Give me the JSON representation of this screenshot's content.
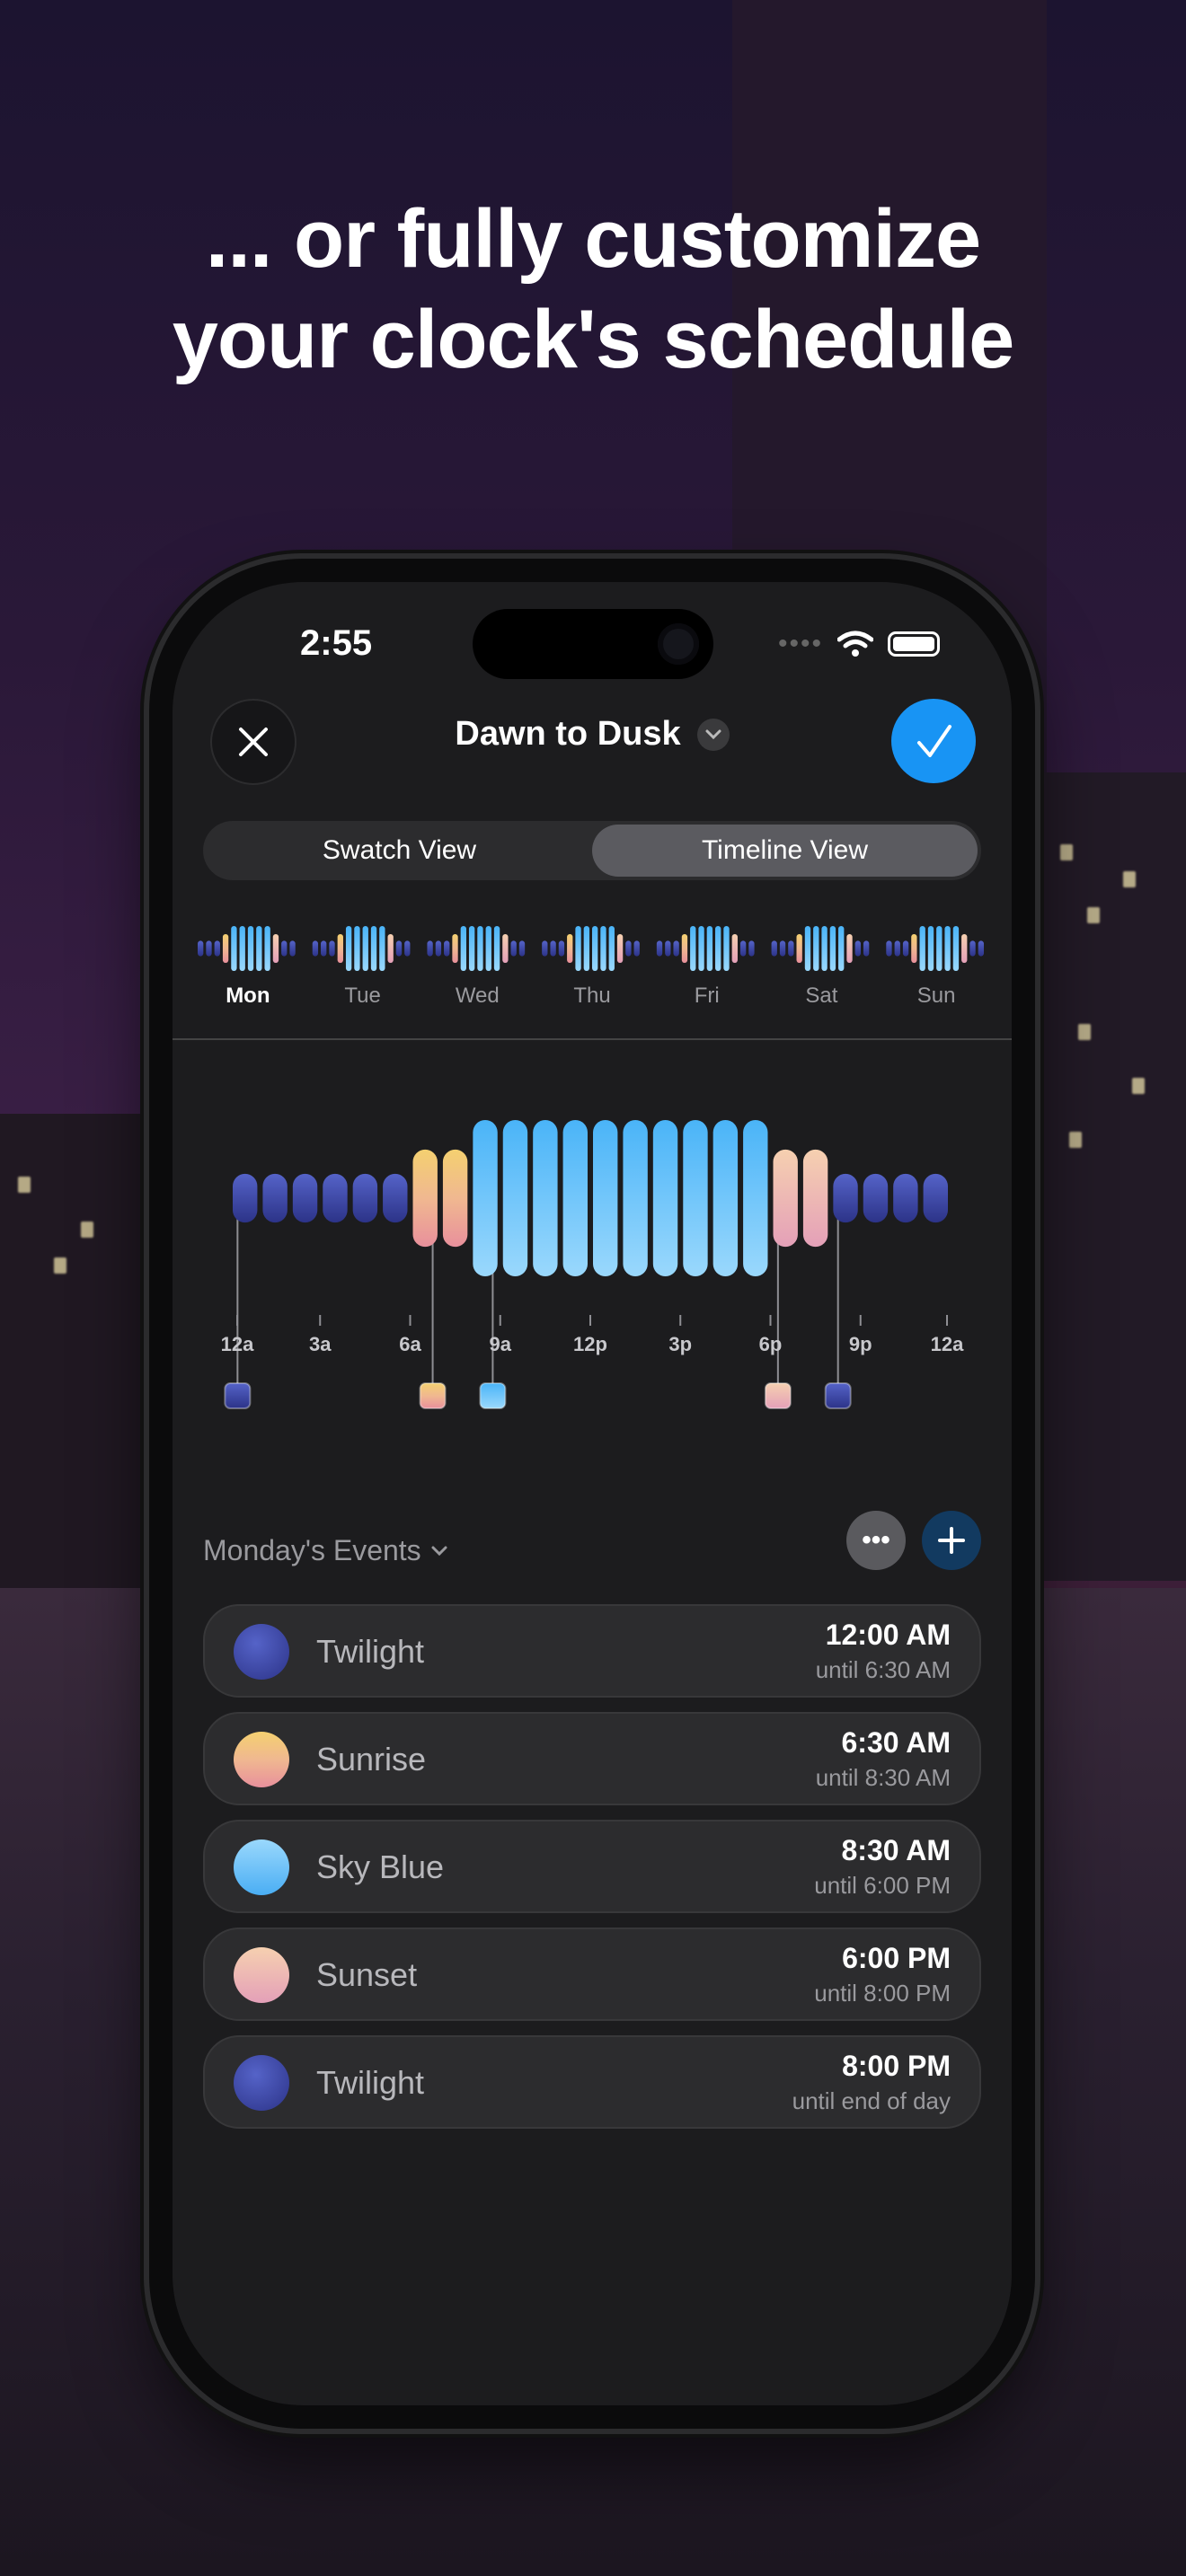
{
  "headline": {
    "line1": "... or fully customize",
    "line2": "your clock's schedule"
  },
  "status_bar": {
    "time": "2:55"
  },
  "nav": {
    "title": "Dawn to Dusk"
  },
  "segment": {
    "options": [
      "Swatch View",
      "Timeline View"
    ],
    "selected": "Timeline View"
  },
  "week": {
    "days": [
      "Mon",
      "Tue",
      "Wed",
      "Thu",
      "Fri",
      "Sat",
      "Sun"
    ],
    "selected_day": "Mon"
  },
  "timeline": {
    "tick_labels": [
      "12a",
      "3a",
      "6a",
      "9a",
      "12p",
      "3p",
      "6p",
      "9p",
      "12a"
    ]
  },
  "events": {
    "header": "Monday's Events",
    "items": [
      {
        "name": "Twilight",
        "time": "12:00 AM",
        "until": "until 6:30 AM",
        "swatch": "twilight"
      },
      {
        "name": "Sunrise",
        "time": "6:30 AM",
        "until": "until 8:30 AM",
        "swatch": "sunrise"
      },
      {
        "name": "Sky Blue",
        "time": "8:30 AM",
        "until": "until 6:00 PM",
        "swatch": "skyblue"
      },
      {
        "name": "Sunset",
        "time": "6:00 PM",
        "until": "until 8:00 PM",
        "swatch": "sunset"
      },
      {
        "name": "Twilight",
        "time": "8:00 PM",
        "until": "until end of day",
        "swatch": "twilight"
      }
    ]
  },
  "colors": {
    "accent": "#1894f4",
    "twilight": "#3d4aa8",
    "sunrise": "#f0c476",
    "skyblue": "#64c0f8",
    "sunset": "#e8a8b4"
  }
}
